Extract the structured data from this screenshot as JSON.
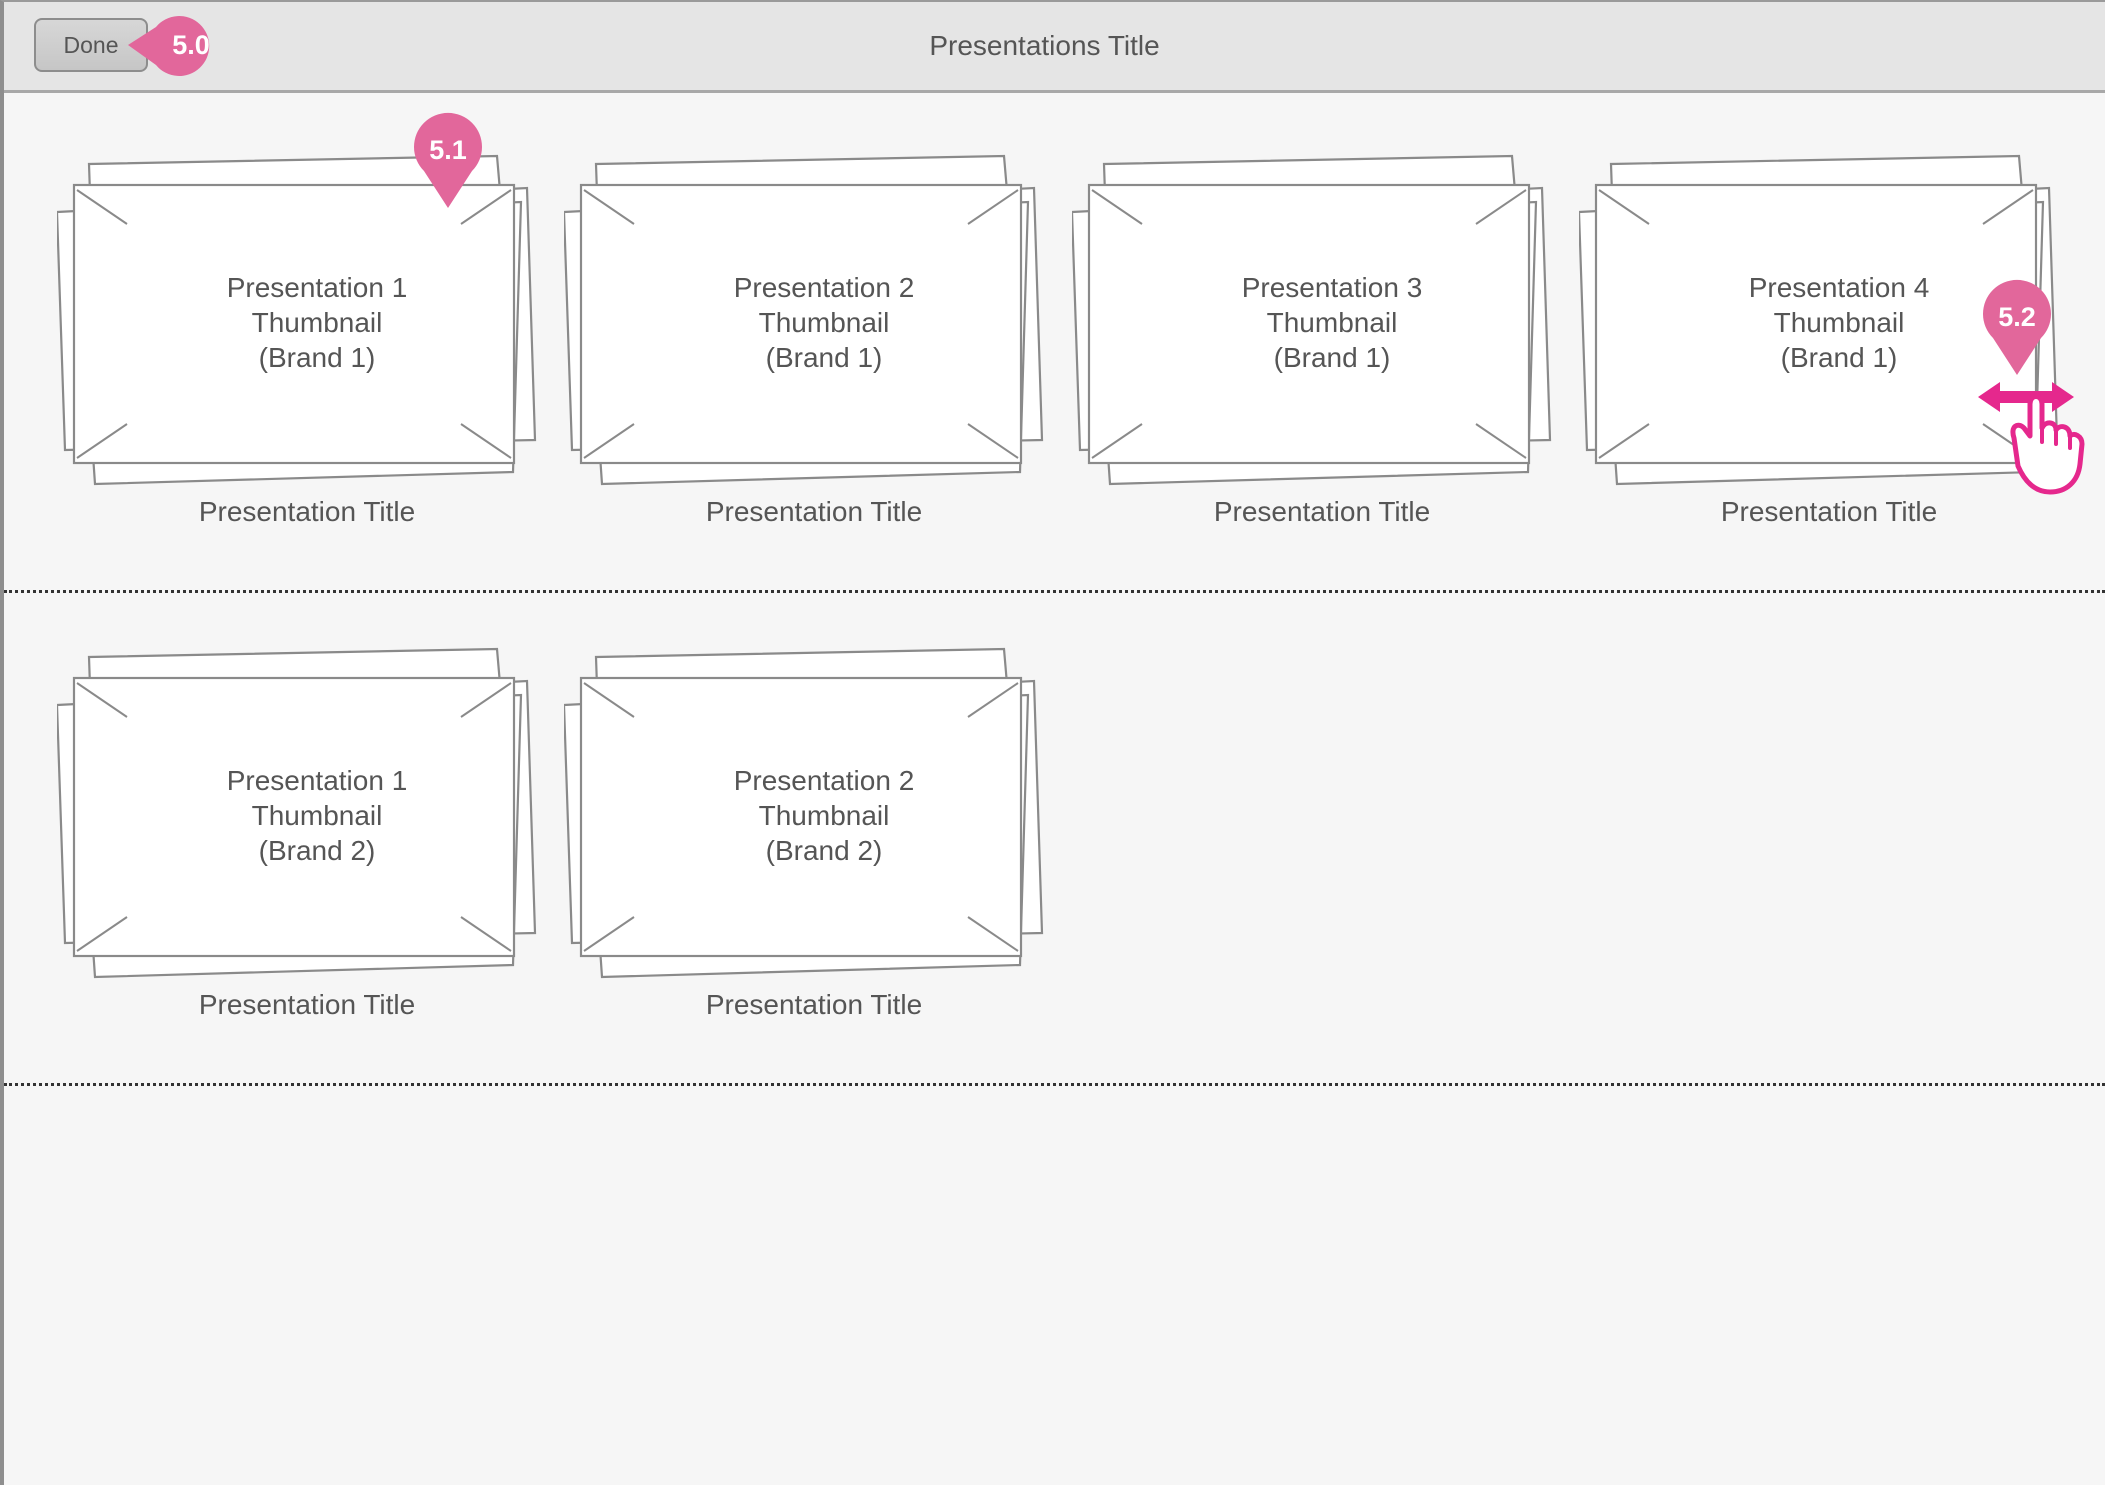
{
  "header": {
    "title": "Presentations Title",
    "done_label": "Done"
  },
  "annotations": {
    "done_marker": "5.0",
    "thumbnail_marker": "5.1",
    "swipe_marker": "5.2",
    "accent_color": "#e2679b",
    "gesture_color": "#e5288d"
  },
  "groups": [
    {
      "presentations": [
        {
          "line1": "Presentation 1",
          "line2": "Thumbnail",
          "line3": "(Brand 1)",
          "title": "Presentation Title"
        },
        {
          "line1": "Presentation 2",
          "line2": "Thumbnail",
          "line3": "(Brand 1)",
          "title": "Presentation Title"
        },
        {
          "line1": "Presentation 3",
          "line2": "Thumbnail",
          "line3": "(Brand 1)",
          "title": "Presentation Title"
        },
        {
          "line1": "Presentation 4",
          "line2": "Thumbnail",
          "line3": "(Brand 1)",
          "title": "Presentation Title"
        }
      ]
    },
    {
      "presentations": [
        {
          "line1": "Presentation 1",
          "line2": "Thumbnail",
          "line3": "(Brand 2)",
          "title": "Presentation Title"
        },
        {
          "line1": "Presentation 2",
          "line2": "Thumbnail",
          "line3": "(Brand 2)",
          "title": "Presentation Title"
        }
      ]
    }
  ]
}
